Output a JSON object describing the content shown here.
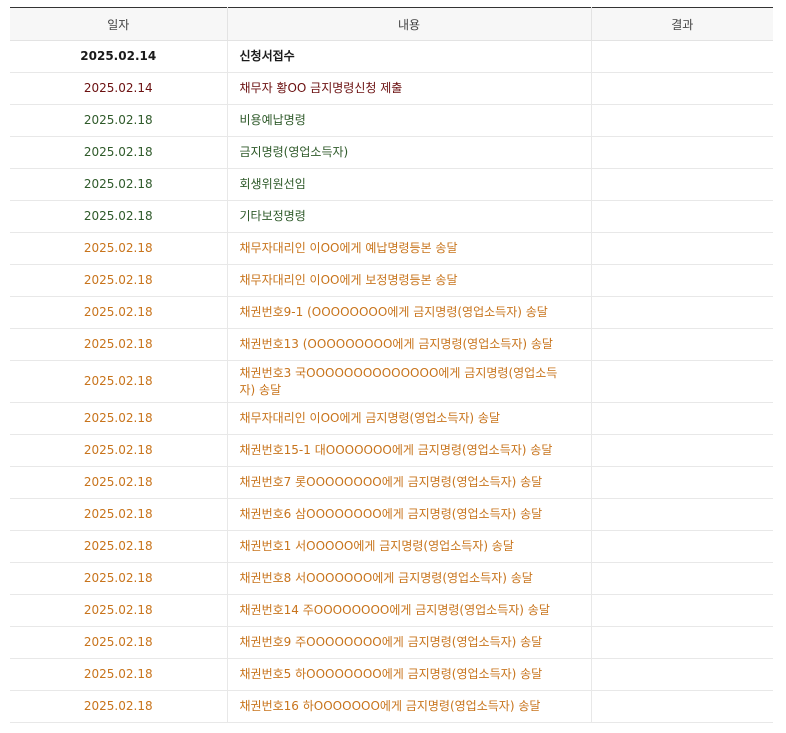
{
  "table": {
    "headers": {
      "date": "일자",
      "content": "내용",
      "result": "결과"
    },
    "status_colors": {
      "black": "#1a1a1a",
      "maroon": "#6b1010",
      "green": "#2f5a2a",
      "orange": "#c8741c"
    },
    "rows": [
      {
        "date": "2025.02.14",
        "content": "신청서접수",
        "result": ""
      },
      {
        "date": "2025.02.14",
        "content": "채무자 황OO 금지명령신청 제출",
        "result": ""
      },
      {
        "date": "2025.02.18",
        "content": "비용예납명령",
        "result": ""
      },
      {
        "date": "2025.02.18",
        "content": "금지명령(영업소득자)",
        "result": ""
      },
      {
        "date": "2025.02.18",
        "content": "회생위원선임",
        "result": ""
      },
      {
        "date": "2025.02.18",
        "content": "기타보정명령",
        "result": ""
      },
      {
        "date": "2025.02.18",
        "content": "채무자대리인 이OO에게 예납명령등본 송달",
        "result": ""
      },
      {
        "date": "2025.02.18",
        "content": "채무자대리인 이OO에게 보정명령등본 송달",
        "result": ""
      },
      {
        "date": "2025.02.18",
        "content": "채권번호9-1 (OOOOOOOO에게 금지명령(영업소득자) 송달",
        "result": ""
      },
      {
        "date": "2025.02.18",
        "content": "채권번호13 (OOOOOOOOO에게 금지명령(영업소득자) 송달",
        "result": ""
      },
      {
        "date": "2025.02.18",
        "content": "채권번호3 국OOOOOOOOOOOOOO에게 금지명령(영업소득자) 송달",
        "result": ""
      },
      {
        "date": "2025.02.18",
        "content": "채무자대리인 이OO에게 금지명령(영업소득자) 송달",
        "result": ""
      },
      {
        "date": "2025.02.18",
        "content": "채권번호15-1 대OOOOOOO에게 금지명령(영업소득자) 송달",
        "result": ""
      },
      {
        "date": "2025.02.18",
        "content": "채권번호7 롯OOOOOOOO에게 금지명령(영업소득자) 송달",
        "result": ""
      },
      {
        "date": "2025.02.18",
        "content": "채권번호6 삼OOOOOOOO에게 금지명령(영업소득자) 송달",
        "result": ""
      },
      {
        "date": "2025.02.18",
        "content": "채권번호1 서OOOOO에게 금지명령(영업소득자) 송달",
        "result": ""
      },
      {
        "date": "2025.02.18",
        "content": "채권번호8 서OOOOOOO에게 금지명령(영업소득자) 송달",
        "result": ""
      },
      {
        "date": "2025.02.18",
        "content": "채권번호14 주OOOOOOOO에게 금지명령(영업소득자) 송달",
        "result": ""
      },
      {
        "date": "2025.02.18",
        "content": "채권번호9 주OOOOOOOO에게 금지명령(영업소득자) 송달",
        "result": ""
      },
      {
        "date": "2025.02.18",
        "content": "채권번호5 하OOOOOOOO에게 금지명령(영업소득자) 송달",
        "result": ""
      },
      {
        "date": "2025.02.18",
        "content": "채권번호16 하OOOOOOO에게 금지명령(영업소득자) 송달",
        "result": ""
      }
    ]
  }
}
